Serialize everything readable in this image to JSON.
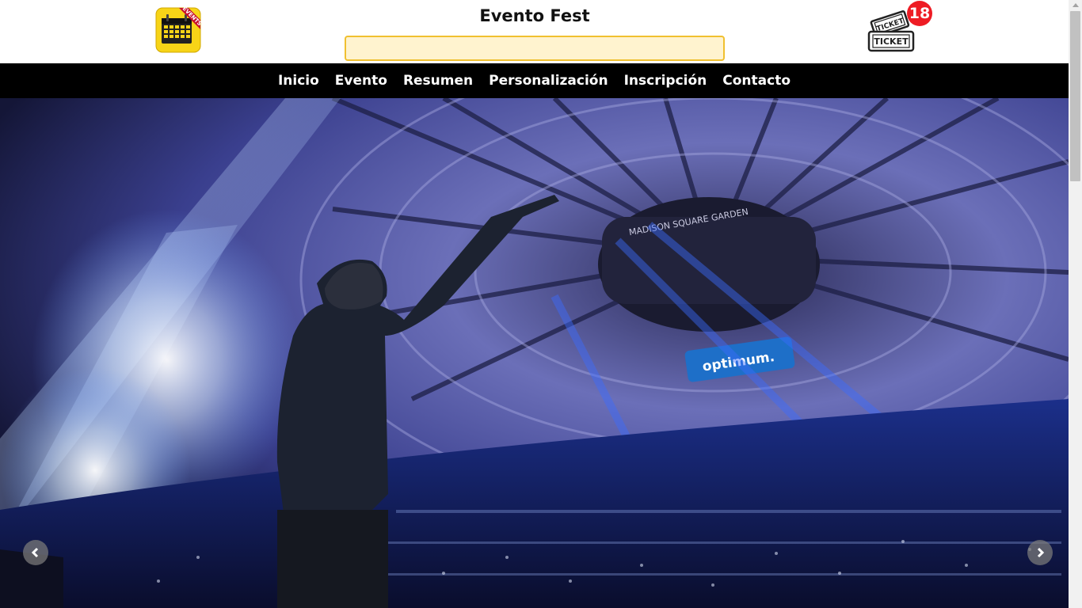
{
  "header": {
    "title": "Evento Fest",
    "logo_icon": "calendar-events-icon",
    "logo_ribbon_text": "EVENTS",
    "search": {
      "value": "",
      "placeholder": ""
    },
    "cart_icon": "ticket-icon",
    "ticket_text": "TICKET",
    "cart_count": "18"
  },
  "nav": {
    "items": [
      {
        "label": "Inicio"
      },
      {
        "label": "Evento"
      },
      {
        "label": "Resumen"
      },
      {
        "label": "Personalización"
      },
      {
        "label": "Inscripción"
      },
      {
        "label": "Contacto"
      }
    ]
  },
  "hero": {
    "venue_sign": "MADISON SQUARE GARDEN",
    "scoreboard_text": "optimum.",
    "prev_icon": "chevron-left-icon",
    "next_icon": "chevron-right-icon"
  },
  "colors": {
    "nav_bg": "#000000",
    "search_bg": "#fff3cf",
    "search_border": "#f0c030",
    "badge": "#ee1c24",
    "hero_bg": "#14163a"
  }
}
